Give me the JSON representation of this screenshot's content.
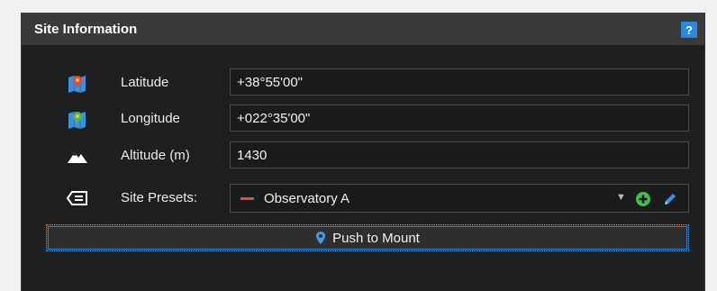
{
  "panel": {
    "title": "Site Information",
    "help_label": "?"
  },
  "fields": {
    "latitude": {
      "label": "Latitude",
      "value": "+38°55'00\"",
      "icon": "latitude-map-icon"
    },
    "longitude": {
      "label": "Longitude",
      "value": "+022°35'00\"",
      "icon": "longitude-map-icon"
    },
    "altitude": {
      "label": "Altitude (m)",
      "value": "1430",
      "icon": "mountain-icon"
    }
  },
  "presets": {
    "label": "Site Presets:",
    "selected": "Observatory A",
    "icon": "tag-list-icon"
  },
  "push_button": {
    "label": "Push to Mount",
    "icon": "location-pin-icon"
  },
  "colors": {
    "accent": "#2b88d8",
    "add_green": "#3fbf4f",
    "dash_red": "#e04a4a"
  }
}
